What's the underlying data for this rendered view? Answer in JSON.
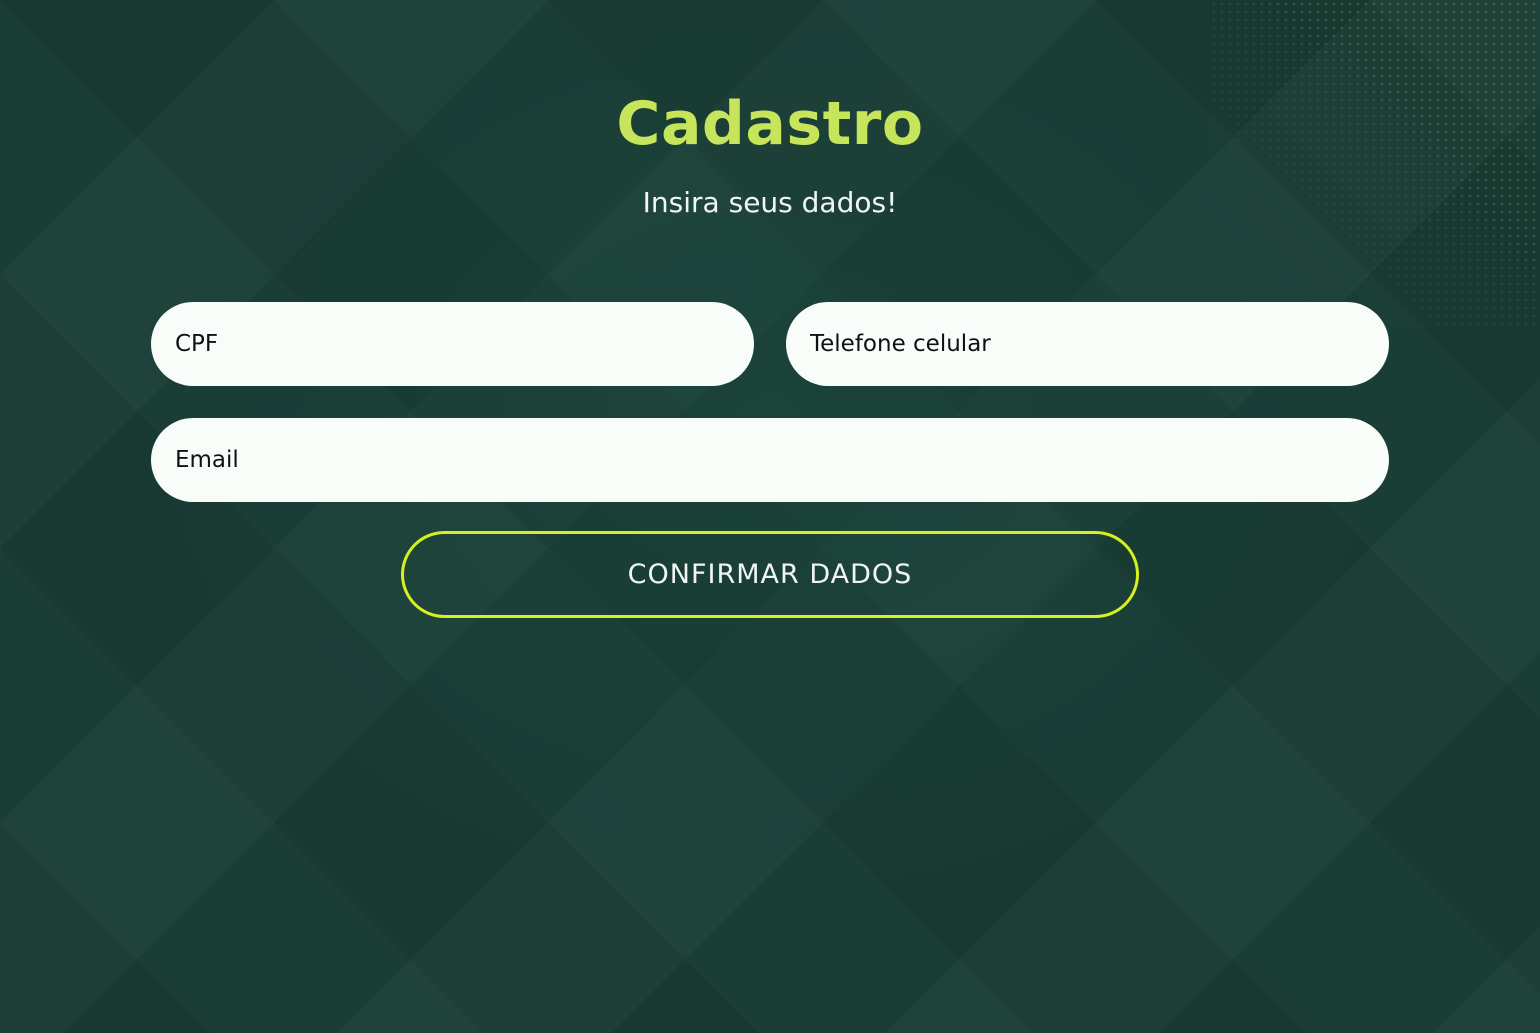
{
  "header": {
    "title": "Cadastro",
    "subtitle": "Insira seus dados!"
  },
  "form": {
    "cpf": {
      "placeholder": "CPF",
      "value": ""
    },
    "phone": {
      "placeholder": "Telefone celular",
      "value": ""
    },
    "email": {
      "placeholder": "Email",
      "value": ""
    },
    "submit_label": "CONFIRMAR DADOS"
  },
  "colors": {
    "background": "#1a3d36",
    "title": "#c6e55a",
    "button_border": "#d7f021",
    "input_background": "#f8fdf9",
    "text_light": "#f1f6f2"
  }
}
